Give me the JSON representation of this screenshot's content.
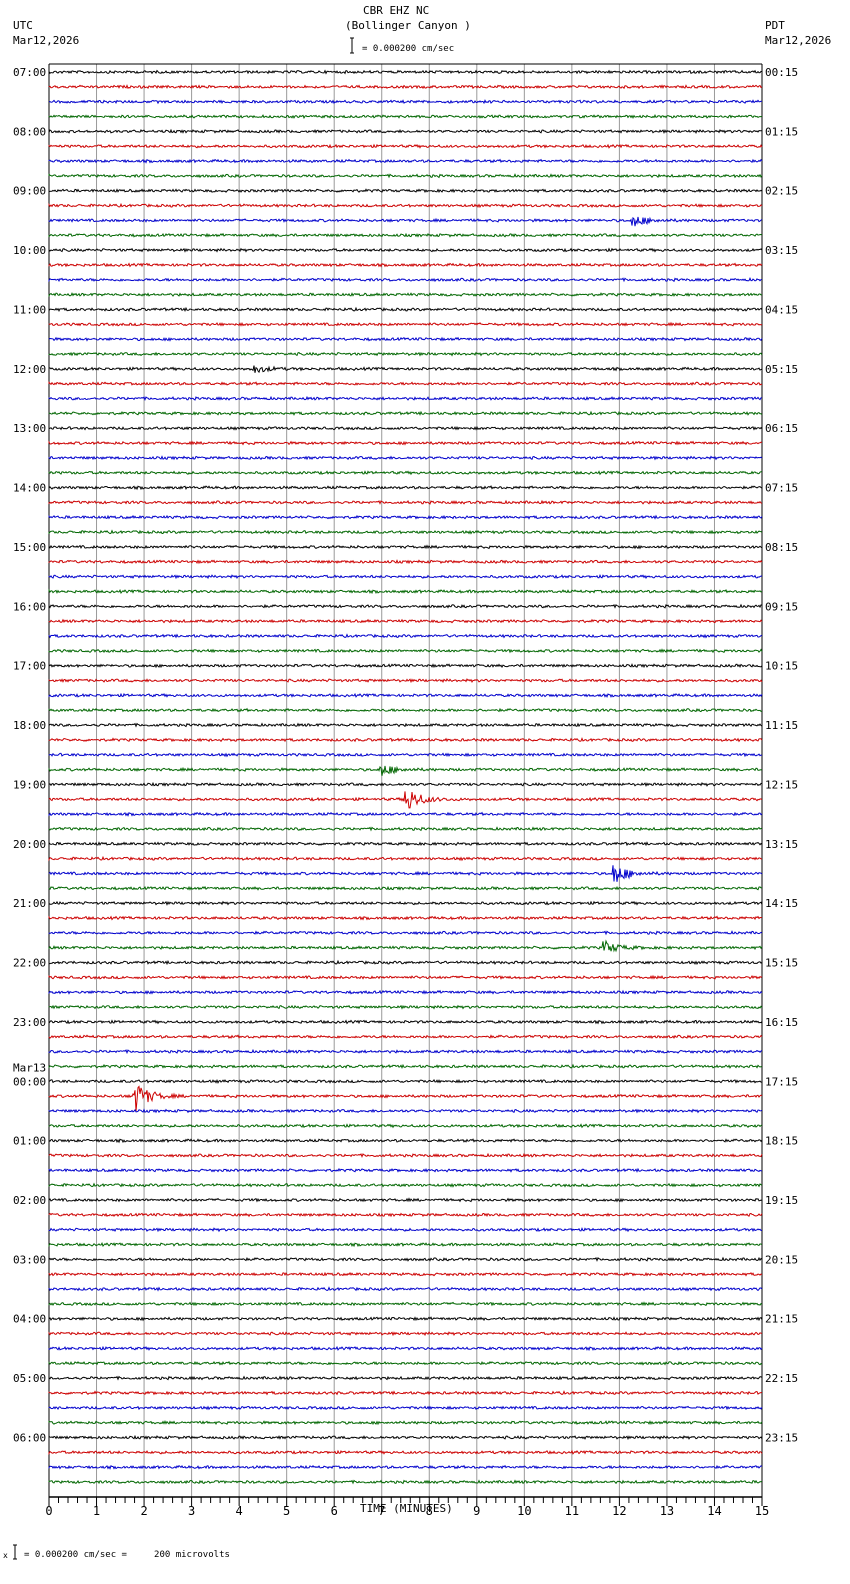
{
  "header": {
    "station": "CBR EHZ NC",
    "location": "(Bollinger Canyon )",
    "left_tz": "UTC",
    "left_date": "Mar12,2026",
    "right_tz": "PDT",
    "right_date": "Mar12,2026",
    "scale_text": "= 0.000200 cm/sec"
  },
  "footer": {
    "scale_text": "= 0.000200 cm/sec =     200 microvolts",
    "prefix": "x"
  },
  "chart_data": {
    "type": "line",
    "title": "CBR EHZ NC (Bollinger Canyon )",
    "xlabel": "TIME (MINUTES)",
    "xlim": [
      0,
      15
    ],
    "x_ticks": [
      "0",
      "1",
      "2",
      "3",
      "4",
      "5",
      "6",
      "7",
      "8",
      "9",
      "10",
      "11",
      "12",
      "13",
      "14",
      "15"
    ],
    "trace_minutes": 15,
    "trace_count": 96,
    "trace_colors": [
      "#000000",
      "#cc0000",
      "#0000cc",
      "#006600"
    ],
    "left_labels": [
      {
        "trace": 0,
        "text": "07:00"
      },
      {
        "trace": 4,
        "text": "08:00"
      },
      {
        "trace": 8,
        "text": "09:00"
      },
      {
        "trace": 12,
        "text": "10:00"
      },
      {
        "trace": 16,
        "text": "11:00"
      },
      {
        "trace": 20,
        "text": "12:00"
      },
      {
        "trace": 24,
        "text": "13:00"
      },
      {
        "trace": 28,
        "text": "14:00"
      },
      {
        "trace": 32,
        "text": "15:00"
      },
      {
        "trace": 36,
        "text": "16:00"
      },
      {
        "trace": 40,
        "text": "17:00"
      },
      {
        "trace": 44,
        "text": "18:00"
      },
      {
        "trace": 48,
        "text": "19:00"
      },
      {
        "trace": 52,
        "text": "20:00"
      },
      {
        "trace": 56,
        "text": "21:00"
      },
      {
        "trace": 60,
        "text": "22:00"
      },
      {
        "trace": 64,
        "text": "23:00"
      },
      {
        "trace": 68,
        "text": "00:00"
      },
      {
        "trace": 72,
        "text": "01:00"
      },
      {
        "trace": 76,
        "text": "02:00"
      },
      {
        "trace": 80,
        "text": "03:00"
      },
      {
        "trace": 84,
        "text": "04:00"
      },
      {
        "trace": 88,
        "text": "05:00"
      },
      {
        "trace": 92,
        "text": "06:00"
      }
    ],
    "date_change_label": {
      "trace": 68,
      "text": "Mar13"
    },
    "right_labels": [
      "00:15",
      "01:15",
      "02:15",
      "03:15",
      "04:15",
      "05:15",
      "06:15",
      "07:15",
      "08:15",
      "09:15",
      "10:15",
      "11:15",
      "12:15",
      "13:15",
      "14:15",
      "15:15",
      "16:15",
      "17:15",
      "18:15",
      "19:15",
      "20:15",
      "21:15",
      "22:15",
      "23:15"
    ],
    "events": [
      {
        "trace": 10,
        "minute": 12.3,
        "amplitude": 6
      },
      {
        "trace": 20,
        "minute": 4.3,
        "amplitude": 4
      },
      {
        "trace": 47,
        "minute": 7.0,
        "amplitude": 6
      },
      {
        "trace": 49,
        "minute": 7.5,
        "amplitude": 14
      },
      {
        "trace": 54,
        "minute": 11.9,
        "amplitude": 10
      },
      {
        "trace": 59,
        "minute": 11.7,
        "amplitude": 6
      },
      {
        "trace": 69,
        "minute": 1.8,
        "amplitude": 16
      }
    ]
  }
}
